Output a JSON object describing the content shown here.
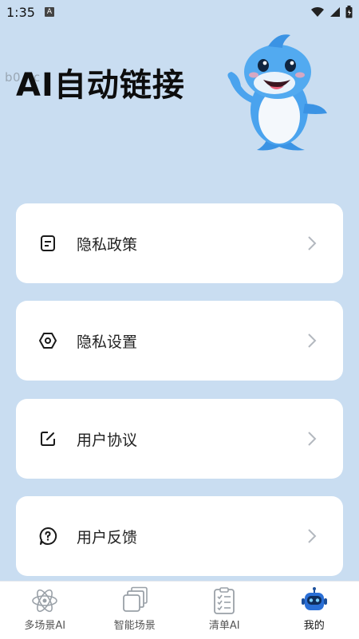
{
  "status": {
    "time": "1:35",
    "notif_icon": "A"
  },
  "watermark": "b0...c",
  "header": {
    "title": "AI自动链接"
  },
  "menu": {
    "items": [
      {
        "label": "隐私政策",
        "icon": "document-icon"
      },
      {
        "label": "隐私设置",
        "icon": "settings-hex-icon"
      },
      {
        "label": "用户协议",
        "icon": "edit-icon"
      },
      {
        "label": "用户反馈",
        "icon": "question-bubble-icon"
      }
    ]
  },
  "tabs": [
    {
      "label": "多场景AI",
      "icon": "atom-icon"
    },
    {
      "label": "智能场景",
      "icon": "layers-icon"
    },
    {
      "label": "清单AI",
      "icon": "checklist-icon"
    },
    {
      "label": "我的",
      "icon": "robot-icon",
      "active": true
    }
  ],
  "colors": {
    "background": "#c9ddf1",
    "card": "#ffffff",
    "accent": "#2a6fd6"
  }
}
